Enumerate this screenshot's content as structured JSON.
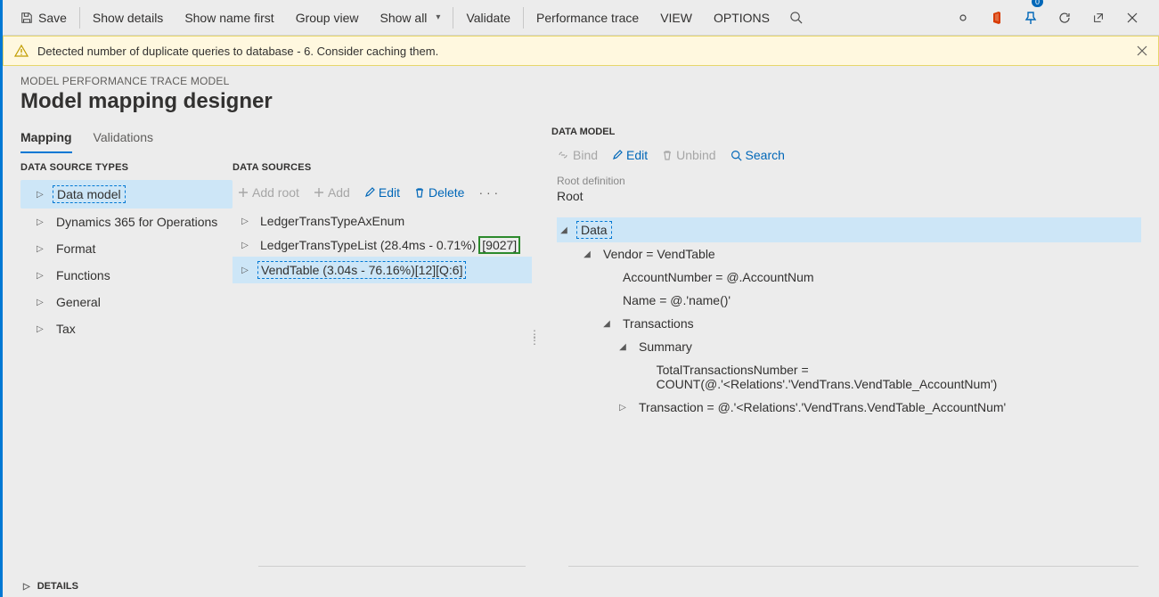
{
  "toolbar": {
    "save": "Save",
    "show_details": "Show details",
    "show_name_first": "Show name first",
    "group_view": "Group view",
    "show_all": "Show all",
    "validate": "Validate",
    "perf_trace": "Performance trace",
    "view": "VIEW",
    "options": "OPTIONS"
  },
  "badge_count": "0",
  "warning_text": "Detected number of duplicate queries to database - 6. Consider caching them.",
  "breadcrumb": "MODEL PERFORMANCE TRACE MODEL",
  "page_title": "Model mapping designer",
  "tabs": {
    "mapping": "Mapping",
    "validations": "Validations"
  },
  "left_header": "DATA SOURCE TYPES",
  "left_items": [
    "Data model",
    "Dynamics 365 for Operations",
    "Format",
    "Functions",
    "General",
    "Tax"
  ],
  "mid_header": "DATA SOURCES",
  "ds_buttons": {
    "add_root": "Add root",
    "add": "Add",
    "edit": "Edit",
    "delete": "Delete"
  },
  "ds_rows": {
    "r0": "LedgerTransTypeAxEnum",
    "r1a": "LedgerTransTypeList (28.4ms - 0.71%)",
    "r1b": "[9027]",
    "r2": "VendTable (3.04s - 76.16%)[12][Q:6]"
  },
  "right_header": "DATA MODEL",
  "dm_buttons": {
    "bind": "Bind",
    "edit": "Edit",
    "unbind": "Unbind",
    "search": "Search"
  },
  "root_definition_label": "Root definition",
  "root_definition_value": "Root",
  "dm_tree": {
    "data": "Data",
    "vendor": "Vendor = VendTable",
    "account": "AccountNumber = @.AccountNum",
    "name": "Name = @.'name()'",
    "transactions": "Transactions",
    "summary": "Summary",
    "total": "TotalTransactionsNumber = COUNT(@.'<Relations'.'VendTrans.VendTable_AccountNum')",
    "transaction": "Transaction = @.'<Relations'.'VendTrans.VendTable_AccountNum'"
  },
  "details_label": "DETAILS"
}
